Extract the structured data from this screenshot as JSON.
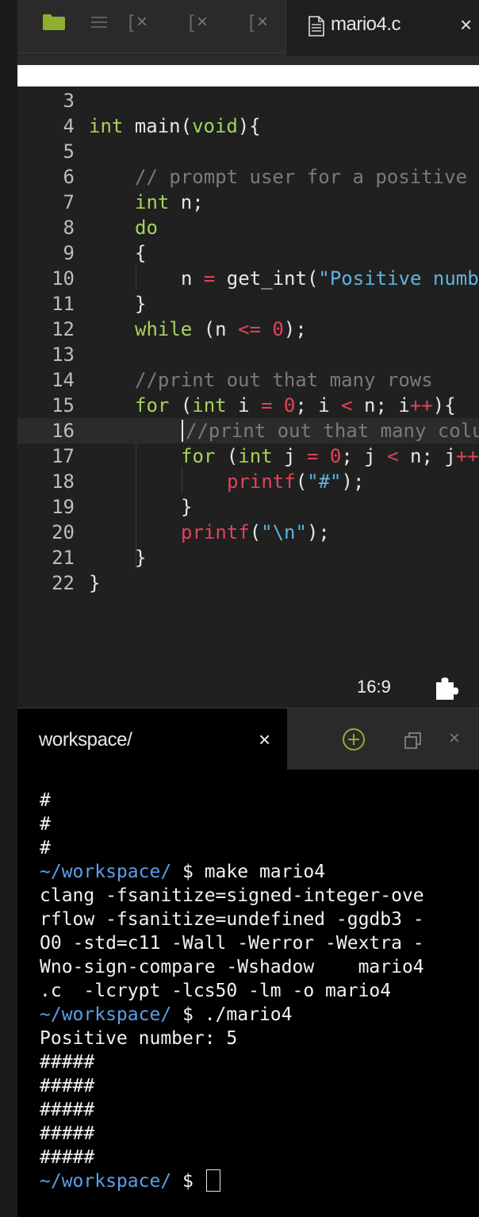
{
  "editor": {
    "active_tab": {
      "title": "mario4.c",
      "close": "×"
    },
    "collapsed_tabs": [
      {
        "bracket": "[",
        "close": "×"
      },
      {
        "bracket": "[",
        "close": "×"
      },
      {
        "bracket": "[",
        "close": "×"
      }
    ],
    "cursor_position": "16:9",
    "lines": [
      {
        "num": "3"
      },
      {
        "num": "4"
      },
      {
        "num": "5"
      },
      {
        "num": "6"
      },
      {
        "num": "7"
      },
      {
        "num": "8"
      },
      {
        "num": "9"
      },
      {
        "num": "10"
      },
      {
        "num": "11"
      },
      {
        "num": "12"
      },
      {
        "num": "13"
      },
      {
        "num": "14"
      },
      {
        "num": "15"
      },
      {
        "num": "16"
      },
      {
        "num": "17"
      },
      {
        "num": "18"
      },
      {
        "num": "19"
      },
      {
        "num": "20"
      },
      {
        "num": "21"
      },
      {
        "num": "22"
      }
    ],
    "code": {
      "l4_int": "int",
      "l4_rest": " main(",
      "l4_void": "void",
      "l4_end": "){",
      "l6_comment": "// prompt user for a positive",
      "l7_int": "int",
      "l7_rest": " n;",
      "l8_do": "do",
      "l9": "{",
      "l10_a": "n ",
      "l10_eq": "=",
      "l10_b": " get_int(",
      "l10_str": "\"Positive numb",
      "l11": "}",
      "l12_while": "while",
      "l12_a": " (n ",
      "l12_op": "<=",
      "l12_sp": " ",
      "l12_num": "0",
      "l12_end": ");",
      "l14_comment": "//print out that many rows",
      "l15_for": "for",
      "l15_a": " (",
      "l15_int": "int",
      "l15_b": " i ",
      "l15_eq": "=",
      "l15_sp": " ",
      "l15_num": "0",
      "l15_c": "; i ",
      "l15_lt": "<",
      "l15_d": " n; i",
      "l15_inc": "++",
      "l15_end": "){",
      "l16_comment": "//print out that many colu",
      "l17_for": "for",
      "l17_a": " (",
      "l17_int": "int",
      "l17_b": " j ",
      "l17_eq": "=",
      "l17_sp": " ",
      "l17_num": "0",
      "l17_c": "; j ",
      "l17_lt": "<",
      "l17_d": " n; j",
      "l17_inc": "++",
      "l18_fn": "printf",
      "l18_a": "(",
      "l18_str": "\"#\"",
      "l18_end": ");",
      "l19": "}",
      "l20_fn": "printf",
      "l20_a": "(",
      "l20_str": "\"\\n\"",
      "l20_end": ");",
      "l21": "}",
      "l22": "}"
    }
  },
  "terminal": {
    "tab_title": "workspace/",
    "tab_close": "×",
    "panel_close": "×",
    "lines": [
      {
        "text": "#"
      },
      {
        "text": "#"
      },
      {
        "text": "#"
      },
      {
        "prompt": "~/workspace/",
        "text": " $ make mario4"
      },
      {
        "text": "clang -fsanitize=signed-integer-ove"
      },
      {
        "text": "rflow -fsanitize=undefined -ggdb3 -"
      },
      {
        "text": "O0 -std=c11 -Wall -Werror -Wextra -"
      },
      {
        "text": "Wno-sign-compare -Wshadow    mario4"
      },
      {
        "text": ".c  -lcrypt -lcs50 -lm -o mario4"
      },
      {
        "prompt": "~/workspace/",
        "text": " $ ./mario4"
      },
      {
        "text": "Positive number: 5"
      },
      {
        "text": "#####"
      },
      {
        "text": "#####"
      },
      {
        "text": "#####"
      },
      {
        "text": "#####"
      },
      {
        "text": "#####"
      },
      {
        "prompt": "~/workspace/",
        "text": " $ "
      }
    ]
  },
  "colors": {
    "keyword": "#a6d25c",
    "comment": "#7a7a7a",
    "operator": "#e0445a",
    "string": "#5fb3e0",
    "prompt": "#5aa0e6",
    "folder": "#8fae2f"
  }
}
